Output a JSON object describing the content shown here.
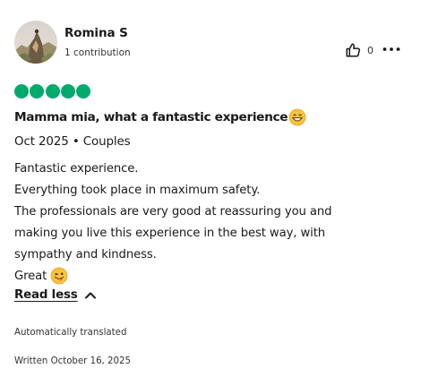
{
  "review": {
    "author": {
      "name": "Romina S",
      "contributions": "1 contribution"
    },
    "helpful_count": "0",
    "rating": {
      "value": 5,
      "max": 5,
      "color": "#00aa6c"
    },
    "title": "Mamma mia, what a fantastic experience",
    "title_emoji_icon": "grinning-face-icon",
    "date_and_type": "Oct 2025 • Couples",
    "body_lines": [
      "Fantastic experience.",
      "Everything took place in maximum safety.",
      "The professionals are very good at reassuring you and",
      "making you live this experience in the best way, with",
      "sympathy and kindness.",
      "Great"
    ],
    "body_emoji_icon": "winking-face-with-tongue-icon",
    "read_less_label": "Read less",
    "translation_note": "Automatically translated",
    "written_date": "Written October 16, 2025"
  }
}
